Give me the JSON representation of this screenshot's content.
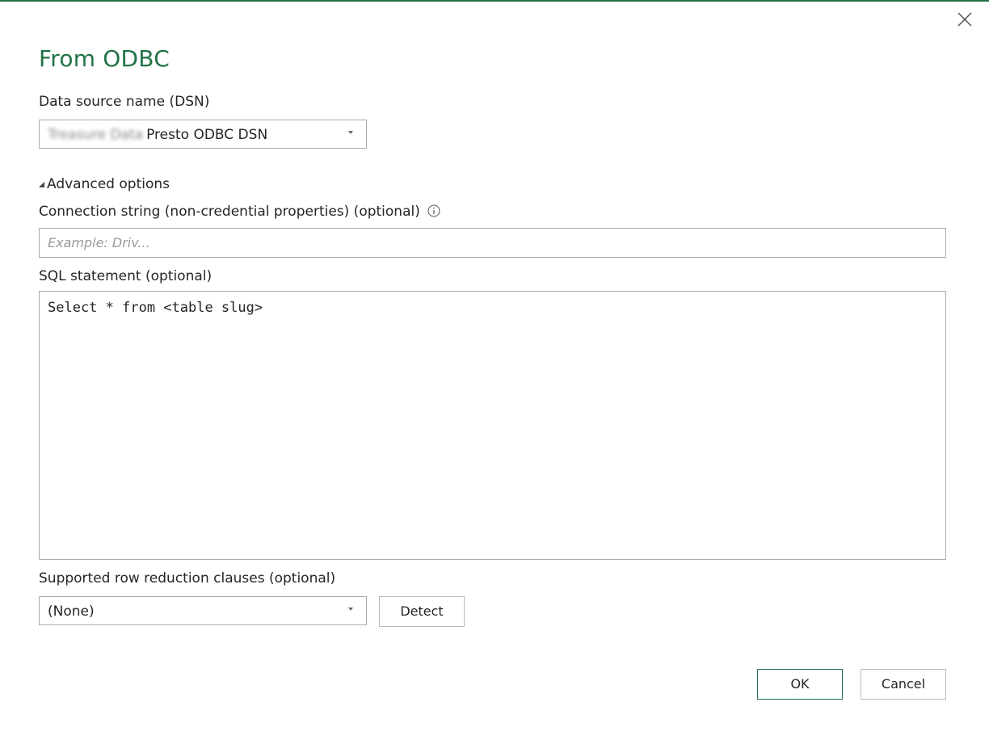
{
  "dialog": {
    "title": "From ODBC",
    "close_icon": "close-icon"
  },
  "dsn": {
    "label": "Data source name (DSN)",
    "value_blurred": "Treasure Data",
    "value": "Presto ODBC DSN"
  },
  "advanced": {
    "label": "Advanced options",
    "expanded": true
  },
  "connection_string": {
    "label": "Connection string (non-credential properties) (optional)",
    "info_icon": "info-icon",
    "placeholder": "Example: Driv...",
    "value": ""
  },
  "sql": {
    "label": "SQL statement (optional)",
    "value": "Select * from <table slug>"
  },
  "row_reduction": {
    "label": "Supported row reduction clauses (optional)",
    "value": "(None)",
    "detect_label": "Detect"
  },
  "footer": {
    "ok_label": "OK",
    "cancel_label": "Cancel"
  },
  "colors": {
    "accent": "#217346",
    "border": "#aaaaaa",
    "text": "#252525"
  }
}
